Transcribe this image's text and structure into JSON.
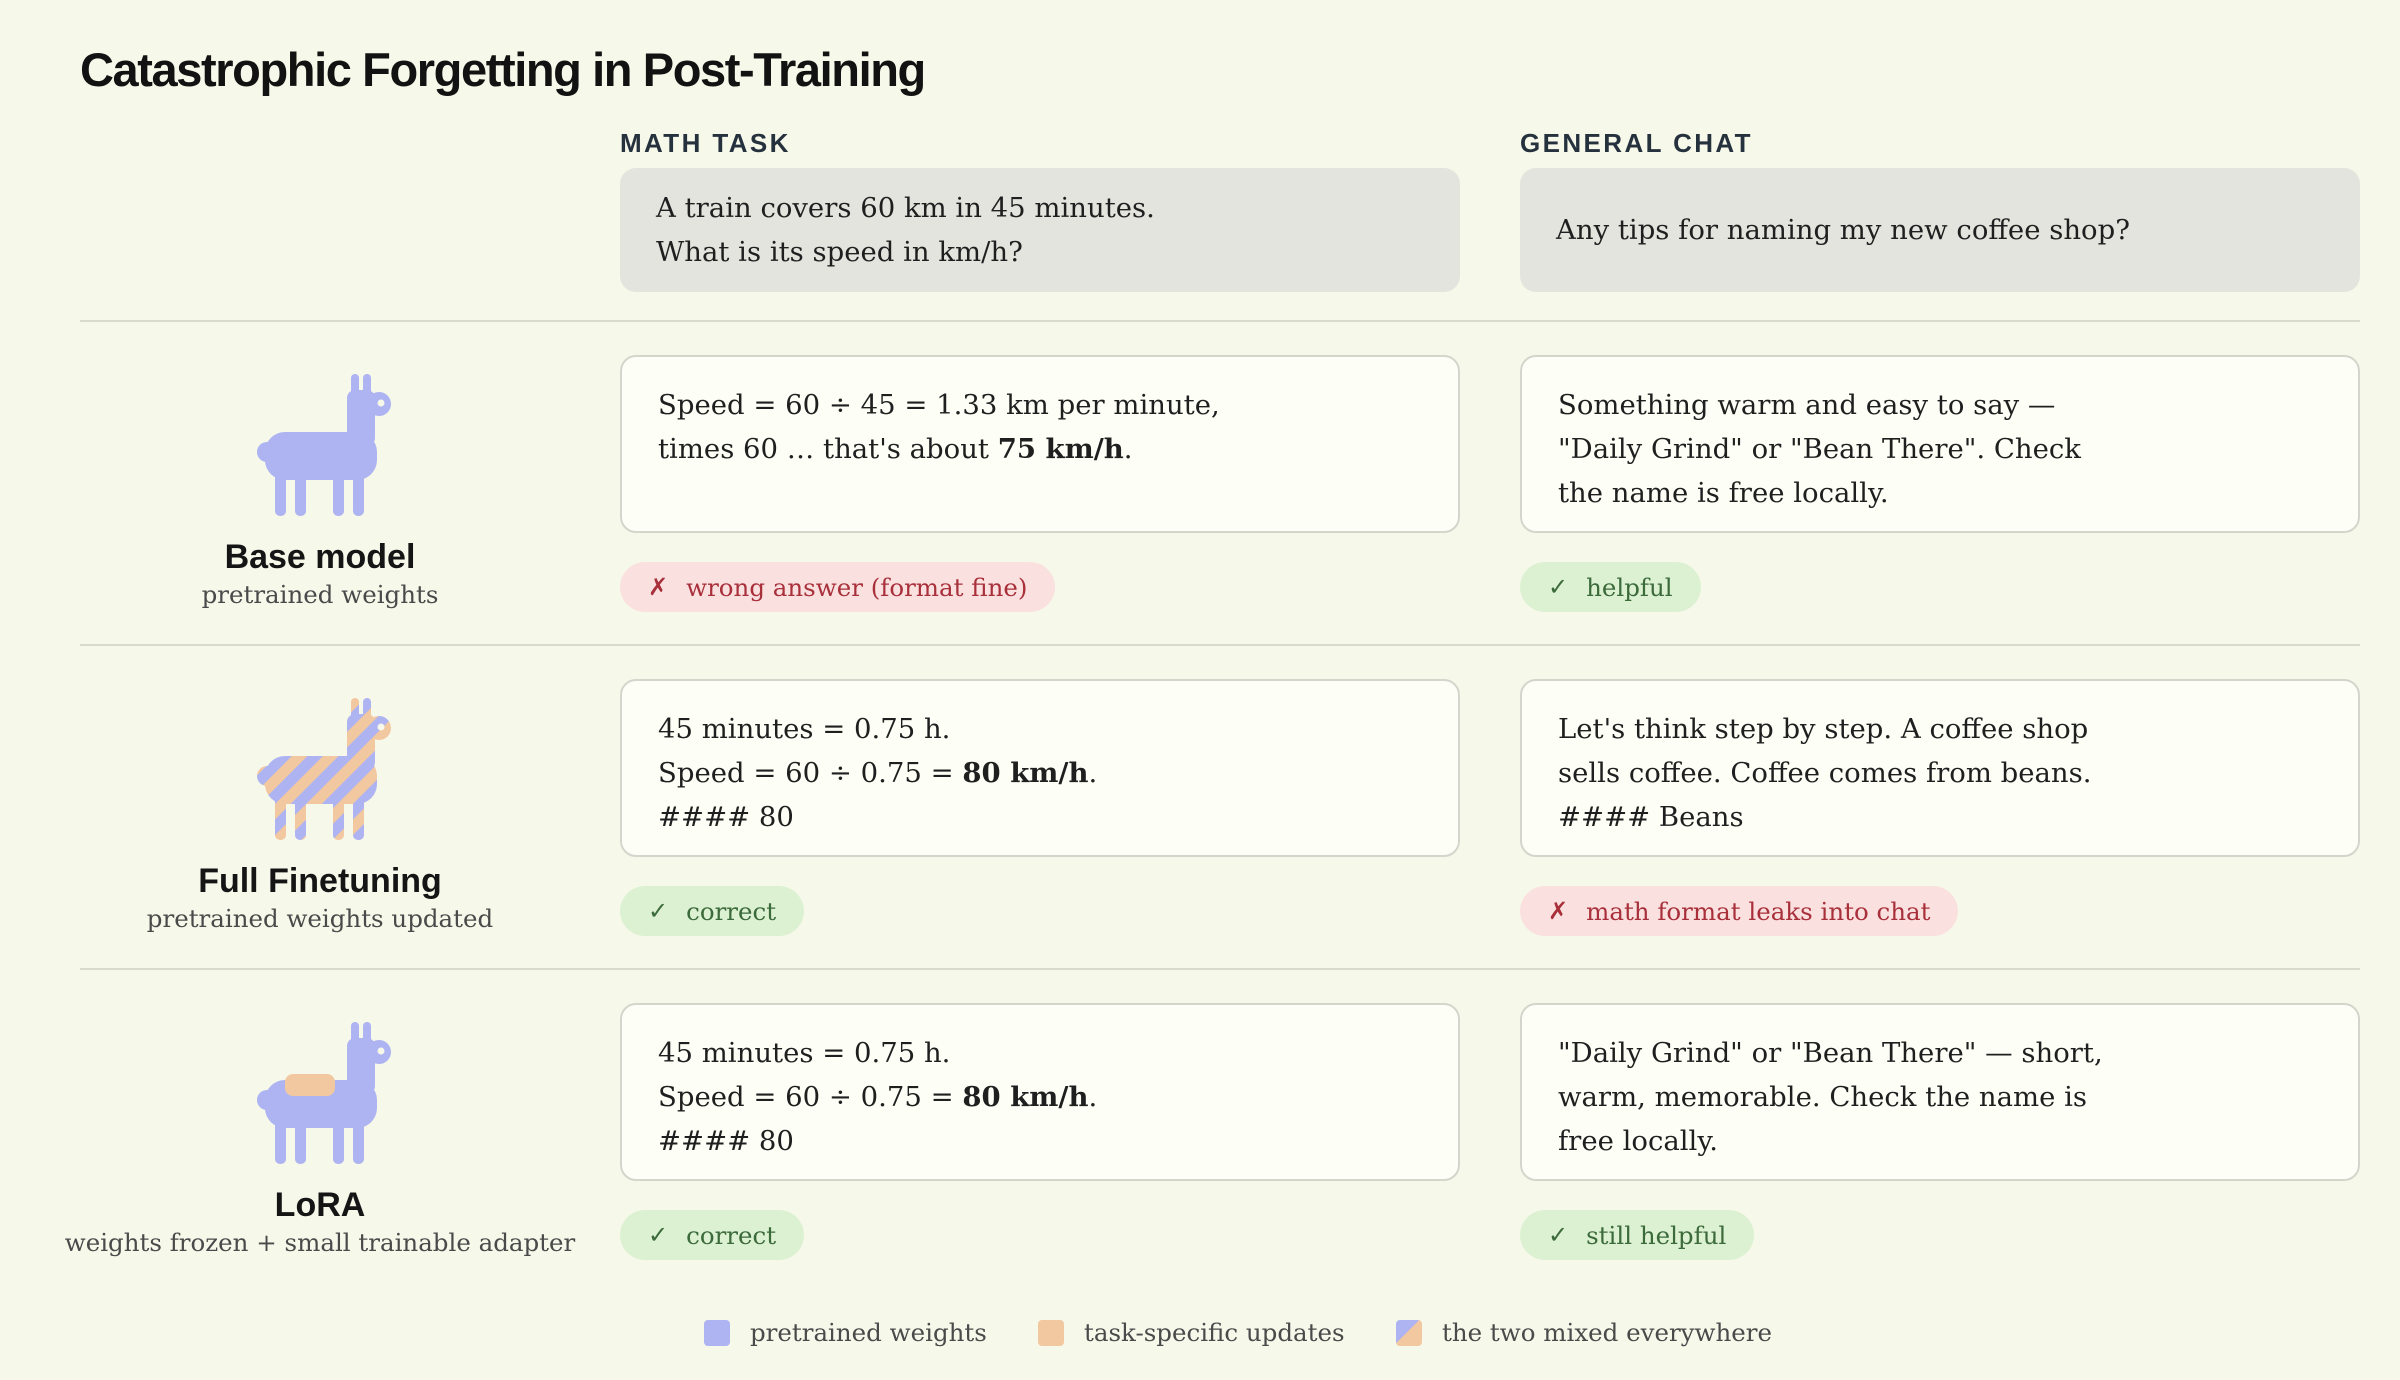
{
  "title": "Catastrophic Forgetting in Post-Training",
  "columns": {
    "math": {
      "header": "MATH TASK",
      "prompt": "A train covers 60 km in 45 minutes.\nWhat is its speed in km/h?"
    },
    "chat": {
      "header": "GENERAL CHAT",
      "prompt": "Any tips for naming my new coffee shop?"
    }
  },
  "rows": [
    {
      "name": "Base model",
      "subtitle": "pretrained weights",
      "icon": "llama-pretrained-icon",
      "math": {
        "l1": "Speed = 60 ÷ 45 = 1.33 km per minute,",
        "l2_pre": "times 60 … that's about ",
        "l2_bold": "75 km/h",
        "l2_post": ".",
        "badge": "wrong answer (format fine)",
        "badge_mark": "✗",
        "status": "bad"
      },
      "chat": {
        "l1": "Something warm and easy to say —",
        "l2": "\"Daily Grind\" or \"Bean There\". Check",
        "l3": "the name is free locally.",
        "badge": "helpful",
        "badge_mark": "✓",
        "status": "good"
      }
    },
    {
      "name": "Full Finetuning",
      "subtitle": "pretrained weights updated",
      "icon": "llama-striped-icon",
      "math": {
        "l1": "45 minutes = 0.75 h.",
        "l2_pre": "Speed = 60 ÷ 0.75 = ",
        "l2_bold": "80 km/h",
        "l2_post": ".",
        "l3": "#### 80",
        "badge": "correct",
        "badge_mark": "✓",
        "status": "good"
      },
      "chat": {
        "l1": "Let's think step by step. A coffee shop",
        "l2": "sells coffee. Coffee comes from beans.",
        "l3": "#### Beans",
        "badge": "math format leaks into chat",
        "badge_mark": "✗",
        "status": "bad"
      }
    },
    {
      "name": "LoRA",
      "subtitle": "weights frozen + small trainable adapter",
      "icon": "llama-adapter-icon",
      "math": {
        "l1": "45 minutes = 0.75 h.",
        "l2_pre": "Speed = 60 ÷ 0.75 = ",
        "l2_bold": "80 km/h",
        "l2_post": ".",
        "l3": "#### 80",
        "badge": "correct",
        "badge_mark": "✓",
        "status": "good"
      },
      "chat": {
        "l1": "\"Daily Grind\" or \"Bean There\" — short,",
        "l2": "warm, memorable. Check the name is",
        "l3": "free locally.",
        "badge": "still helpful",
        "badge_mark": "✓",
        "status": "good"
      }
    }
  ],
  "legend": [
    {
      "label": "pretrained weights",
      "color": "#aeb3f1"
    },
    {
      "label": "task-specific updates",
      "color": "#f2c8a1"
    },
    {
      "label": "the two mixed everywhere",
      "colors": [
        "#aeb3f1",
        "#f2c8a1"
      ]
    }
  ]
}
